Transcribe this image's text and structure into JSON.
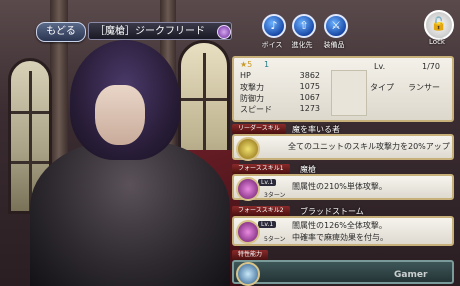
{
  "header": {
    "back_label": "もどる",
    "unit_name": "［魔槍］ジークフリード",
    "icons": [
      {
        "name": "voice-icon",
        "glyph": "♪",
        "label": "ボイス"
      },
      {
        "name": "evolve-icon",
        "glyph": "⇧",
        "label": "進化先"
      },
      {
        "name": "equipment-icon",
        "glyph": "⚔",
        "label": "装備品"
      }
    ],
    "lock_label": "Lock"
  },
  "stats": {
    "rarity": "★5",
    "rank": "1",
    "lv_label": "Lv.",
    "lv_value": "1/70",
    "hp_label": "HP",
    "hp": "3862",
    "atk_label": "攻撃力",
    "atk": "1075",
    "def_label": "防御力",
    "def": "1067",
    "spd_label": "スピード",
    "spd": "1273",
    "type_label": "タイプ",
    "type_value": "ランサー"
  },
  "skills": {
    "leader": {
      "tag": "リーダースキル",
      "name": "魔を率いる者",
      "desc": "全てのユニットのスキル攻撃力を20%アップ"
    },
    "force1": {
      "tag": "フォーススキル1",
      "name": "魔槍",
      "lv": "Lv.1",
      "turn": "3ターン",
      "desc": "闇属性の210%単体攻撃。"
    },
    "force2": {
      "tag": "フォーススキル2",
      "name": "ブラッドストーム",
      "lv": "Lv.1",
      "turn": "5ターン",
      "desc1": "闇属性の126%全体攻撃。",
      "desc2": "中確率で麻痺効果を付与。"
    },
    "special": {
      "tag": "特性能力"
    }
  },
  "watermark": "Gamer"
}
